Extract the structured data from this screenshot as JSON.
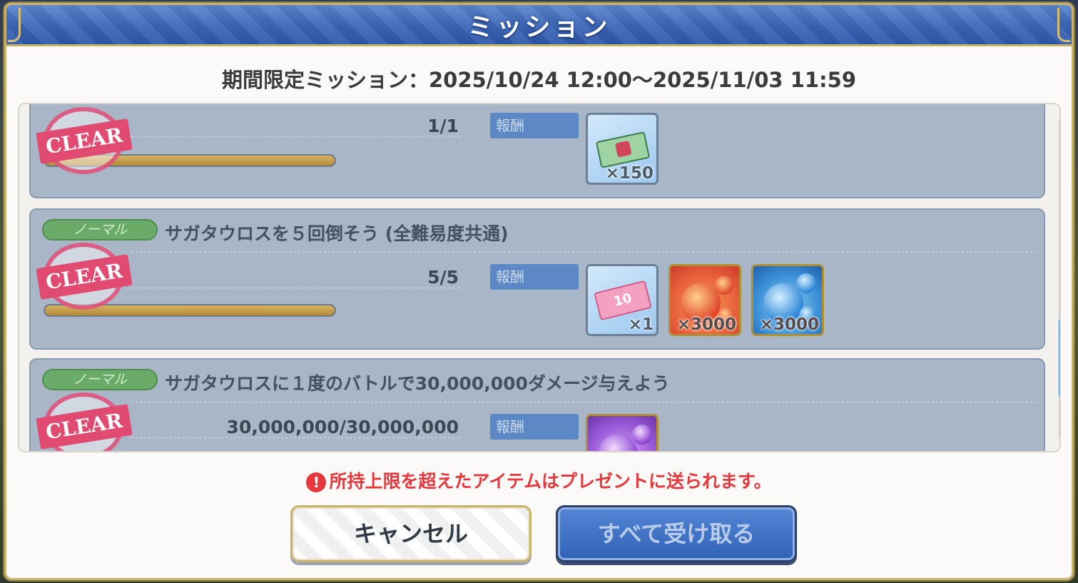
{
  "dialog": {
    "title": "ミッション",
    "period": "期間限定ミッション：2025/10/24 12:00〜2025/11/03 11:59",
    "warning": "所持上限を超えたアイテムはプレゼントに送られます。",
    "warning_icon": "!",
    "buttons": {
      "cancel": "キャンセル",
      "receive_all": "すべて受け取る"
    }
  },
  "missions": [
    {
      "progress": "1/1",
      "progress_fraction": 1.0,
      "stamp": "CLEAR",
      "reward_label": "報酬",
      "rewards": [
        {
          "icon": "ticket-icon",
          "qty": "×150"
        }
      ]
    },
    {
      "badge": "ノーマル",
      "title": "サガタウロスを５回倒そう (全難易度共通)",
      "progress": "5/5",
      "progress_fraction": 1.0,
      "stamp": "CLEAR",
      "reward_label": "報酬",
      "rewards": [
        {
          "icon": "gacha-ticket-10-icon",
          "qty": "×1"
        },
        {
          "icon": "fire-orb-icon",
          "qty": "×3000"
        },
        {
          "icon": "water-orb-icon",
          "qty": "×3000"
        }
      ]
    },
    {
      "badge": "ノーマル",
      "title": "サガタウロスに１度のバトルで30,000,000ダメージ与えよう",
      "progress": "30,000,000/30,000,000",
      "progress_fraction": 1.0,
      "stamp": "CLEAR",
      "reward_label": "報酬",
      "rewards": [
        {
          "icon": "dark-orb-icon",
          "qty": ""
        }
      ]
    }
  ],
  "colors": {
    "title_bar": "#3b66b8",
    "badge_normal": "#6aab6a",
    "clear_stamp": "#e14b72",
    "warning": "#e4383d",
    "accept_button": "#2f62b6"
  }
}
